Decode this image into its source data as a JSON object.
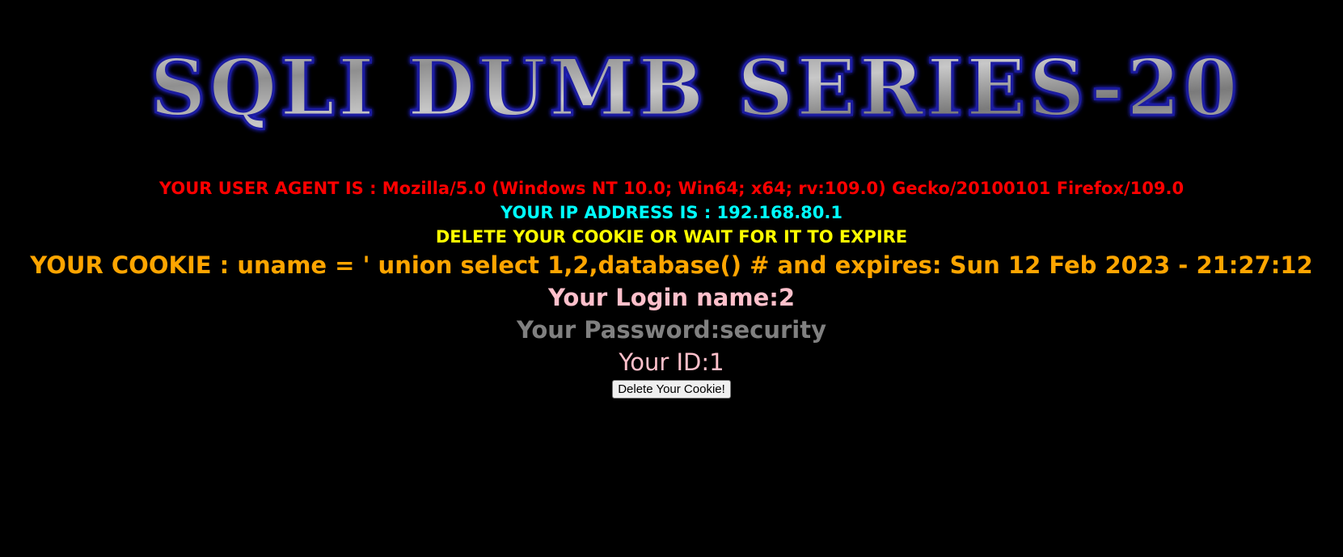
{
  "banner": {
    "title": "SQLI DUMB SERIES-20"
  },
  "info": {
    "user_agent": "YOUR USER AGENT IS : Mozilla/5.0 (Windows NT 10.0; Win64; x64; rv:109.0) Gecko/20100101 Firefox/109.0",
    "ip_address": "YOUR IP ADDRESS IS : 192.168.80.1",
    "delete_notice": "DELETE YOUR COOKIE OR WAIT FOR IT TO EXPIRE",
    "cookie": "YOUR COOKIE : uname = ' union select 1,2,database() # and expires: Sun 12 Feb 2023 - 21:27:12",
    "login_name": "Your Login name:2",
    "password": "Your Password:security",
    "id": "Your ID:1"
  },
  "actions": {
    "delete_button_label": "Delete Your Cookie!"
  },
  "colors": {
    "background": "#000000",
    "user_agent": "#ff0000",
    "ip_address": "#00ffff",
    "delete_notice": "#ffff00",
    "cookie": "#ffa500",
    "login_name": "#ffc0cb",
    "password": "#808080",
    "id": "#ffc0cb"
  }
}
